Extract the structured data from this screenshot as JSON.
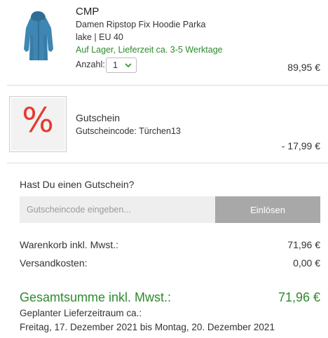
{
  "item": {
    "brand": "CMP",
    "name": "Damen Ripstop Fix Hoodie Parka",
    "variant": "lake | EU 40",
    "availability": "Auf Lager, Lieferzeit ca. 3-5 Werktage",
    "qty_label": "Anzahl:",
    "qty_value": "1",
    "price": "89,95 €",
    "image_icon": "parka-product-image"
  },
  "voucher": {
    "icon": "percent-icon",
    "title": "Gutschein",
    "code_line": "Gutscheincode: Türchen13",
    "discount": "- 17,99 €"
  },
  "voucher_form": {
    "question": "Hast Du einen Gutschein?",
    "placeholder": "Gutscheincode eingeben...",
    "button": "Einlösen"
  },
  "summary": {
    "subtotal_label": "Warenkorb inkl. Mwst.:",
    "subtotal_value": "71,96 €",
    "shipping_label": "Versandkosten:",
    "shipping_value": "0,00 €",
    "total_label": "Gesamtsumme inkl. Mwst.:",
    "total_value": "71,96 €",
    "delivery_label": "Geplanter Lieferzeitraum ca.:",
    "delivery_range": "Freitag, 17. Dezember 2021 bis Montag, 20. Dezember 2021"
  },
  "colors": {
    "accent_green": "#2e8b2e",
    "percent_red": "#e53b2d",
    "button_gray": "#a8a8a8"
  }
}
